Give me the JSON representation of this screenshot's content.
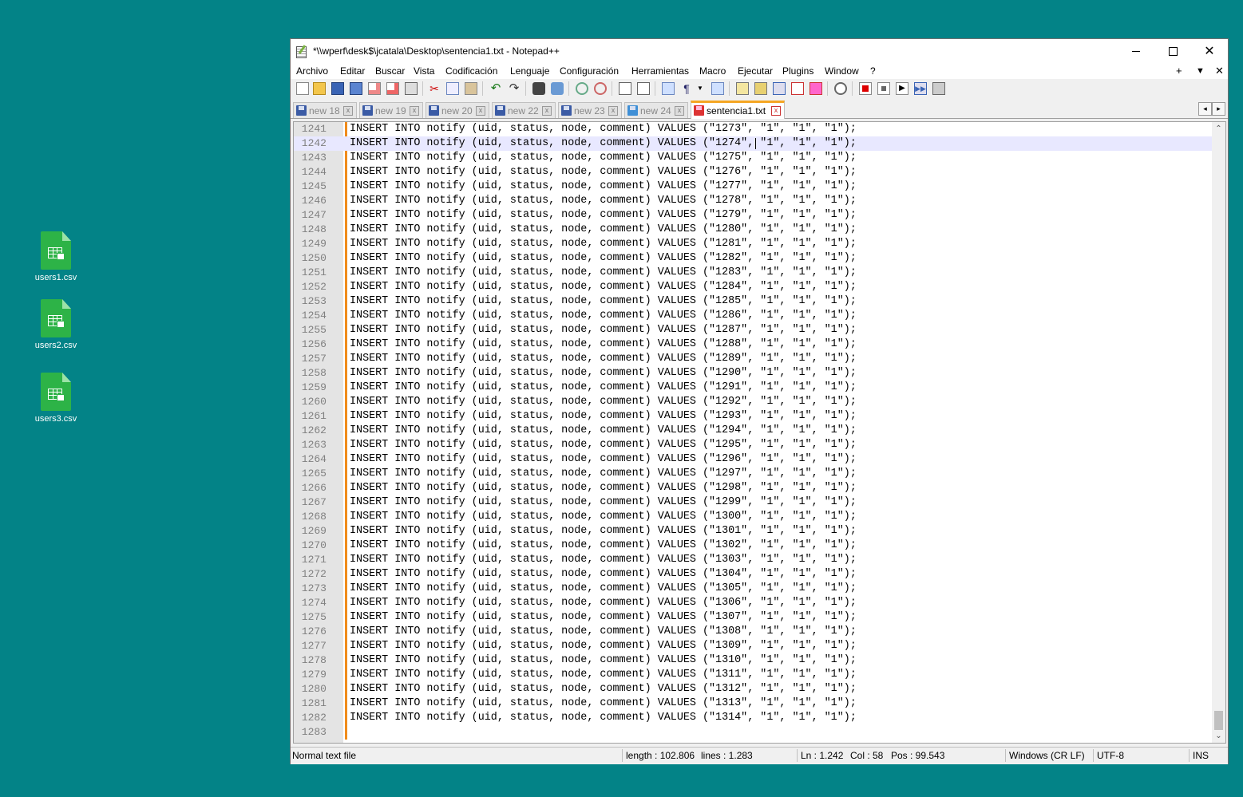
{
  "desktop": {
    "icons": [
      {
        "label": "users1.csv"
      },
      {
        "label": "users2.csv"
      },
      {
        "label": "users3.csv"
      }
    ]
  },
  "window": {
    "title": "*\\\\wperf\\desk$\\jcatala\\Desktop\\sentencia1.txt - Notepad++",
    "controls": {
      "minimize": "minimize-icon",
      "maximize": "maximize-icon",
      "close": "✕"
    }
  },
  "menu": {
    "items": [
      "Archivo",
      "Editar",
      "Buscar",
      "Vista",
      "Codificación",
      "Lenguaje",
      "Configuración",
      "Herramientas",
      "Macro",
      "Ejecutar",
      "Plugins",
      "Window",
      "?"
    ],
    "right": {
      "plus": "+",
      "dropdown": "▼",
      "close": "✕"
    }
  },
  "toolbar": {
    "buttons": [
      "new-file-icon",
      "open-file-icon",
      "save-icon",
      "save-all-icon",
      "close-icon",
      "close-all-icon",
      "print-icon",
      "cut-icon",
      "copy-icon",
      "paste-icon",
      "undo-icon",
      "redo-icon",
      "find-icon",
      "replace-icon",
      "zoom-in-icon",
      "zoom-out-icon",
      "sync-vertical-icon",
      "sync-horizontal-icon",
      "word-wrap-icon",
      "show-all-chars-icon",
      "indent-guide-icon",
      "user-lang-icon",
      "doc-map-icon",
      "function-list-icon",
      "folder-workspace-icon",
      "monitor-icon",
      "record-macro-icon",
      "stop-macro-icon",
      "play-macro-icon",
      "run-macro-multiple-icon",
      "save-macro-icon"
    ]
  },
  "tabs": [
    {
      "label": "new 18",
      "active": false
    },
    {
      "label": "new 19",
      "active": false
    },
    {
      "label": "new 20",
      "active": false
    },
    {
      "label": "new 22",
      "active": false
    },
    {
      "label": "new 23",
      "active": false
    },
    {
      "label": "new 24",
      "active": false
    },
    {
      "label": "sentencia1.txt",
      "active": true
    }
  ],
  "tab_close_glyph": "x",
  "tab_scroll": {
    "left": "◂",
    "right": "▸"
  },
  "editor": {
    "current_line": 1242,
    "lines": [
      {
        "n": "1241",
        "text": "INSERT INTO notify (uid, status, node, comment) VALUES (\"1273\", \"1\", \"1\", \"1\");"
      },
      {
        "n": "1242",
        "text": "INSERT INTO notify (uid, status, node, comment) VALUES (\"1274\", \"1\", \"1\", \"1\");"
      },
      {
        "n": "1243",
        "text": "INSERT INTO notify (uid, status, node, comment) VALUES (\"1275\", \"1\", \"1\", \"1\");"
      },
      {
        "n": "1244",
        "text": "INSERT INTO notify (uid, status, node, comment) VALUES (\"1276\", \"1\", \"1\", \"1\");"
      },
      {
        "n": "1245",
        "text": "INSERT INTO notify (uid, status, node, comment) VALUES (\"1277\", \"1\", \"1\", \"1\");"
      },
      {
        "n": "1246",
        "text": "INSERT INTO notify (uid, status, node, comment) VALUES (\"1278\", \"1\", \"1\", \"1\");"
      },
      {
        "n": "1247",
        "text": "INSERT INTO notify (uid, status, node, comment) VALUES (\"1279\", \"1\", \"1\", \"1\");"
      },
      {
        "n": "1248",
        "text": "INSERT INTO notify (uid, status, node, comment) VALUES (\"1280\", \"1\", \"1\", \"1\");"
      },
      {
        "n": "1249",
        "text": "INSERT INTO notify (uid, status, node, comment) VALUES (\"1281\", \"1\", \"1\", \"1\");"
      },
      {
        "n": "1250",
        "text": "INSERT INTO notify (uid, status, node, comment) VALUES (\"1282\", \"1\", \"1\", \"1\");"
      },
      {
        "n": "1251",
        "text": "INSERT INTO notify (uid, status, node, comment) VALUES (\"1283\", \"1\", \"1\", \"1\");"
      },
      {
        "n": "1252",
        "text": "INSERT INTO notify (uid, status, node, comment) VALUES (\"1284\", \"1\", \"1\", \"1\");"
      },
      {
        "n": "1253",
        "text": "INSERT INTO notify (uid, status, node, comment) VALUES (\"1285\", \"1\", \"1\", \"1\");"
      },
      {
        "n": "1254",
        "text": "INSERT INTO notify (uid, status, node, comment) VALUES (\"1286\", \"1\", \"1\", \"1\");"
      },
      {
        "n": "1255",
        "text": "INSERT INTO notify (uid, status, node, comment) VALUES (\"1287\", \"1\", \"1\", \"1\");"
      },
      {
        "n": "1256",
        "text": "INSERT INTO notify (uid, status, node, comment) VALUES (\"1288\", \"1\", \"1\", \"1\");"
      },
      {
        "n": "1257",
        "text": "INSERT INTO notify (uid, status, node, comment) VALUES (\"1289\", \"1\", \"1\", \"1\");"
      },
      {
        "n": "1258",
        "text": "INSERT INTO notify (uid, status, node, comment) VALUES (\"1290\", \"1\", \"1\", \"1\");"
      },
      {
        "n": "1259",
        "text": "INSERT INTO notify (uid, status, node, comment) VALUES (\"1291\", \"1\", \"1\", \"1\");"
      },
      {
        "n": "1260",
        "text": "INSERT INTO notify (uid, status, node, comment) VALUES (\"1292\", \"1\", \"1\", \"1\");"
      },
      {
        "n": "1261",
        "text": "INSERT INTO notify (uid, status, node, comment) VALUES (\"1293\", \"1\", \"1\", \"1\");"
      },
      {
        "n": "1262",
        "text": "INSERT INTO notify (uid, status, node, comment) VALUES (\"1294\", \"1\", \"1\", \"1\");"
      },
      {
        "n": "1263",
        "text": "INSERT INTO notify (uid, status, node, comment) VALUES (\"1295\", \"1\", \"1\", \"1\");"
      },
      {
        "n": "1264",
        "text": "INSERT INTO notify (uid, status, node, comment) VALUES (\"1296\", \"1\", \"1\", \"1\");"
      },
      {
        "n": "1265",
        "text": "INSERT INTO notify (uid, status, node, comment) VALUES (\"1297\", \"1\", \"1\", \"1\");"
      },
      {
        "n": "1266",
        "text": "INSERT INTO notify (uid, status, node, comment) VALUES (\"1298\", \"1\", \"1\", \"1\");"
      },
      {
        "n": "1267",
        "text": "INSERT INTO notify (uid, status, node, comment) VALUES (\"1299\", \"1\", \"1\", \"1\");"
      },
      {
        "n": "1268",
        "text": "INSERT INTO notify (uid, status, node, comment) VALUES (\"1300\", \"1\", \"1\", \"1\");"
      },
      {
        "n": "1269",
        "text": "INSERT INTO notify (uid, status, node, comment) VALUES (\"1301\", \"1\", \"1\", \"1\");"
      },
      {
        "n": "1270",
        "text": "INSERT INTO notify (uid, status, node, comment) VALUES (\"1302\", \"1\", \"1\", \"1\");"
      },
      {
        "n": "1271",
        "text": "INSERT INTO notify (uid, status, node, comment) VALUES (\"1303\", \"1\", \"1\", \"1\");"
      },
      {
        "n": "1272",
        "text": "INSERT INTO notify (uid, status, node, comment) VALUES (\"1304\", \"1\", \"1\", \"1\");"
      },
      {
        "n": "1273",
        "text": "INSERT INTO notify (uid, status, node, comment) VALUES (\"1305\", \"1\", \"1\", \"1\");"
      },
      {
        "n": "1274",
        "text": "INSERT INTO notify (uid, status, node, comment) VALUES (\"1306\", \"1\", \"1\", \"1\");"
      },
      {
        "n": "1275",
        "text": "INSERT INTO notify (uid, status, node, comment) VALUES (\"1307\", \"1\", \"1\", \"1\");"
      },
      {
        "n": "1276",
        "text": "INSERT INTO notify (uid, status, node, comment) VALUES (\"1308\", \"1\", \"1\", \"1\");"
      },
      {
        "n": "1277",
        "text": "INSERT INTO notify (uid, status, node, comment) VALUES (\"1309\", \"1\", \"1\", \"1\");"
      },
      {
        "n": "1278",
        "text": "INSERT INTO notify (uid, status, node, comment) VALUES (\"1310\", \"1\", \"1\", \"1\");"
      },
      {
        "n": "1279",
        "text": "INSERT INTO notify (uid, status, node, comment) VALUES (\"1311\", \"1\", \"1\", \"1\");"
      },
      {
        "n": "1280",
        "text": "INSERT INTO notify (uid, status, node, comment) VALUES (\"1312\", \"1\", \"1\", \"1\");"
      },
      {
        "n": "1281",
        "text": "INSERT INTO notify (uid, status, node, comment) VALUES (\"1313\", \"1\", \"1\", \"1\");"
      },
      {
        "n": "1282",
        "text": "INSERT INTO notify (uid, status, node, comment) VALUES (\"1314\", \"1\", \"1\", \"1\");"
      },
      {
        "n": "1283",
        "text": ""
      }
    ],
    "scroll": {
      "up": "⌃",
      "down": "⌄"
    }
  },
  "status": {
    "type": "Normal text file",
    "length": "length : 102.806",
    "lines": "lines : 1.283",
    "ln": "Ln : 1.242",
    "col": "Col : 58",
    "pos": "Pos : 99.543",
    "eol": "Windows (CR LF)",
    "encoding": "UTF-8",
    "mode": "INS"
  },
  "colors": {
    "desktop": "#038387",
    "change_bar": "#f08c1c",
    "current_line": "#e8e8ff",
    "csv_icon": "#2db347"
  }
}
